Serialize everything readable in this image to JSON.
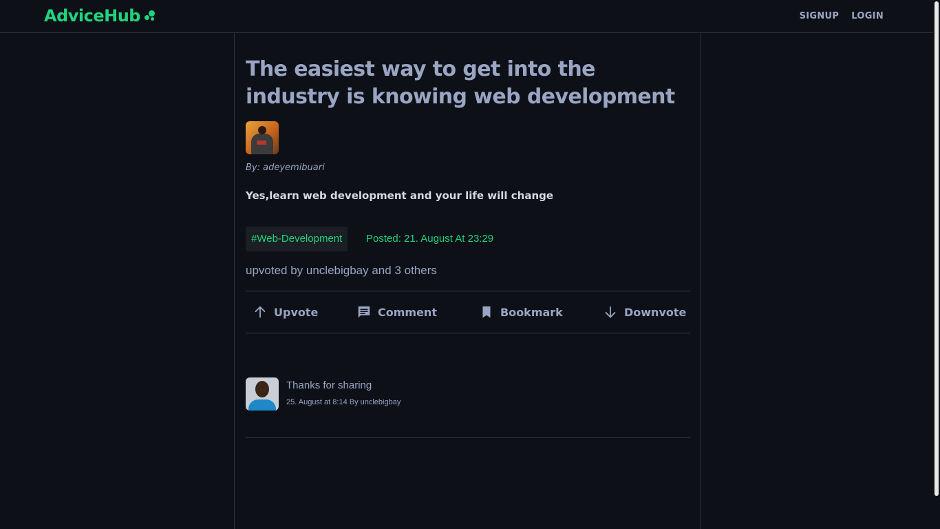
{
  "header": {
    "logo": "AdviceHub",
    "nav": {
      "signup": "SIGNUP",
      "login": "LOGIN"
    }
  },
  "post": {
    "title": "The easiest way to get into the industry is knowing web development",
    "byline": "By: adeyemibuari",
    "body": "Yes,learn web development and your life will change",
    "tag": "#Web-Development",
    "posted": "Posted: 21. August At 23:29",
    "upvoted": "upvoted by unclebigbay and 3 others"
  },
  "actions": {
    "upvote": "Upvote",
    "comment": "Comment",
    "bookmark": "Bookmark",
    "downvote": "Downvote"
  },
  "comments": [
    {
      "text": "Thanks for sharing",
      "meta": "25. August at 8:14 By unclebigbay"
    }
  ],
  "colors": {
    "accent": "#22d37d",
    "text": "#9aa5c4",
    "background": "#0d1117"
  }
}
